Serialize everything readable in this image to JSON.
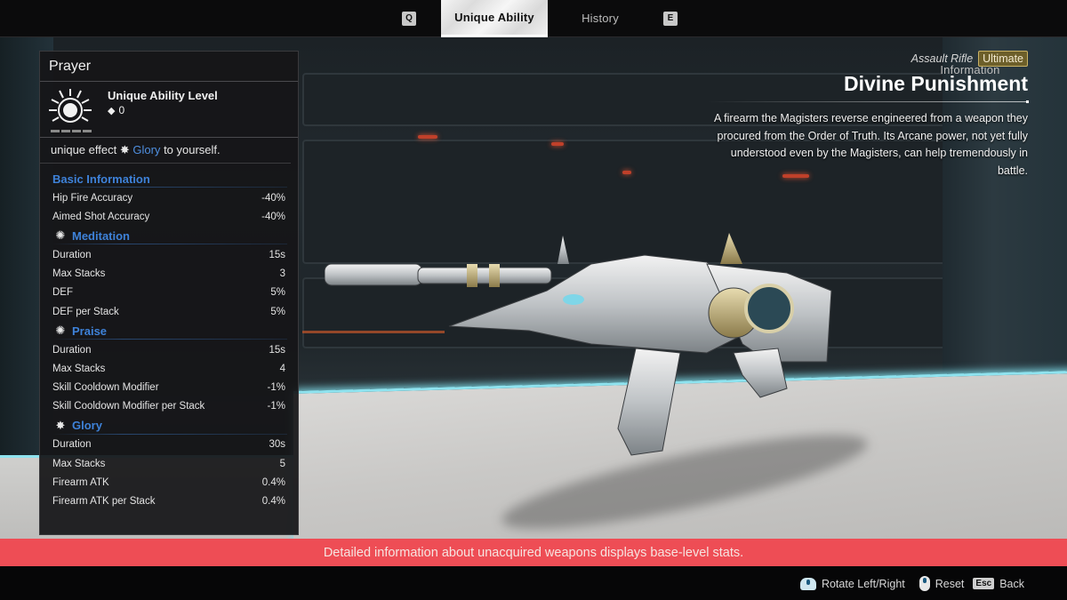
{
  "tabs": {
    "prev_key": "Q",
    "next_key": "E",
    "items": [
      {
        "label": "Information",
        "active": false
      },
      {
        "label": "Unique Ability",
        "active": true
      },
      {
        "label": "History",
        "active": false
      }
    ]
  },
  "panel": {
    "title": "Prayer",
    "ability_level_label": "Unique Ability Level",
    "ability_level_value": "0",
    "effect_prefix": "unique effect",
    "effect_keyword": "Glory",
    "effect_suffix": "to yourself.",
    "sections": [
      {
        "title": "Basic Information",
        "icon": "",
        "rows": [
          {
            "label": "Hip Fire Accuracy",
            "value": "-40%"
          },
          {
            "label": "Aimed Shot Accuracy",
            "value": "-40%"
          }
        ]
      },
      {
        "title": "Meditation",
        "icon": "meditation-icon",
        "rows": [
          {
            "label": "Duration",
            "value": "15s"
          },
          {
            "label": "Max Stacks",
            "value": "3"
          },
          {
            "label": "DEF",
            "value": "5%"
          },
          {
            "label": "DEF per Stack",
            "value": "5%"
          }
        ]
      },
      {
        "title": "Praise",
        "icon": "praise-icon",
        "rows": [
          {
            "label": "Duration",
            "value": "15s"
          },
          {
            "label": "Max Stacks",
            "value": "4"
          },
          {
            "label": "Skill Cooldown Modifier",
            "value": "-1%"
          },
          {
            "label": "Skill Cooldown Modifier per Stack",
            "value": "-1%"
          }
        ]
      },
      {
        "title": "Glory",
        "icon": "glory-icon",
        "rows": [
          {
            "label": "Duration",
            "value": "30s"
          },
          {
            "label": "Max Stacks",
            "value": "5"
          },
          {
            "label": "Firearm ATK",
            "value": "0.4%"
          },
          {
            "label": "Firearm ATK per Stack",
            "value": "0.4%"
          }
        ]
      }
    ]
  },
  "weapon": {
    "type": "Assault Rifle",
    "rarity": "Ultimate",
    "name": "Divine Punishment",
    "description": "A firearm the Magisters reverse engineered from a weapon they procured from the Order of Truth. Its Arcane power, not yet fully understood even by the Magisters, can help tremendously in battle."
  },
  "notice": "Detailed information about unacquired weapons displays base-level stats.",
  "hints": [
    {
      "icon": "mouse-drag-icon",
      "label": "Rotate Left/Right"
    },
    {
      "icon": "mouse-icon",
      "label": "Reset"
    },
    {
      "key": "Esc",
      "label": "Back"
    }
  ],
  "colors": {
    "accent_blue": "#3e82d9",
    "rarity_gold": "#c9b265",
    "notice_red": "#ee4d55"
  }
}
